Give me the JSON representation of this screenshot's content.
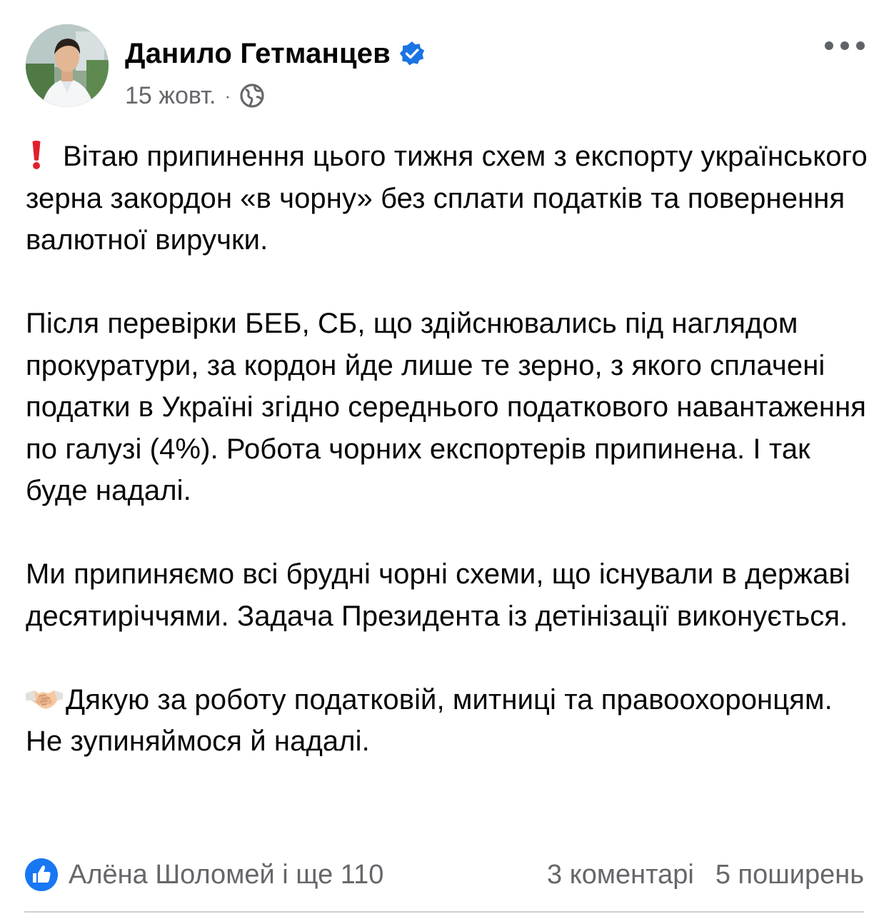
{
  "post": {
    "author": {
      "name": "Данило Гетманцев",
      "verified": true,
      "avatar_icon": "profile-photo"
    },
    "date": "15 жовт.",
    "separator": "·",
    "audience_icon": "globe-icon",
    "menu_icon": "more-options-icon",
    "paragraphs": [
      {
        "emoji": "red-exclamation-icon",
        "text": "Вітаю припинення цього тижня схем з експорту українського зерна закордон «в чорну» без сплати податків та повернення валютної виручки."
      },
      {
        "text": "Після перевірки БЕБ, СБ, що здійснювались під наглядом прокуратури, за кордон йде лише  те зерно, з якого сплачені податки в Україні згідно середнього податкового навантаження по галузі (4%). Робота чорних експортерів припинена. І так буде надалі."
      },
      {
        "text": "Ми припиняємо всі брудні чорні схеми, що існували в державі десятиріччями. Задача Президента із детінізації виконується."
      },
      {
        "emoji": "handshake-icon",
        "text": "Дякую за роботу податковій, митниці та правоохоронцям. Не зупиняймося й надалі."
      }
    ],
    "footer": {
      "reactions_icon": "like-icon",
      "reactors": "Алёна Шоломей і ще 110",
      "comments": "3 коментарі",
      "shares": "5 поширень"
    }
  },
  "colors": {
    "text_primary": "#050505",
    "text_secondary": "#65676b",
    "verified_blue": "#1b74e4",
    "like_blue": "#1877f2",
    "divider": "#ced0d4"
  }
}
